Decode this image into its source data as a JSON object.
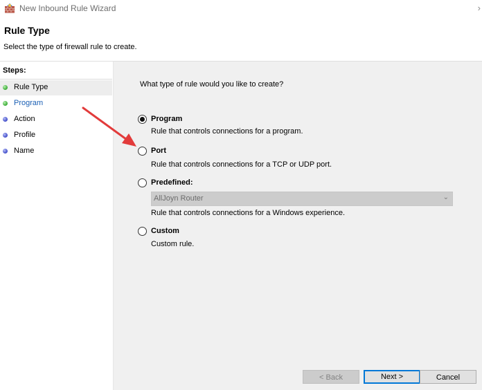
{
  "window": {
    "title": "New Inbound Rule Wizard"
  },
  "header": {
    "title": "Rule Type",
    "subtitle": "Select the type of firewall rule to create."
  },
  "steps": {
    "label": "Steps:",
    "items": [
      {
        "label": "Rule Type"
      },
      {
        "label": "Program"
      },
      {
        "label": "Action"
      },
      {
        "label": "Profile"
      },
      {
        "label": "Name"
      }
    ]
  },
  "content": {
    "question": "What type of rule would you like to create?",
    "options": [
      {
        "title": "Program",
        "desc": "Rule that controls connections for a program.",
        "selected": true
      },
      {
        "title": "Port",
        "desc": "Rule that controls connections for a TCP or UDP port.",
        "selected": false
      },
      {
        "title": "Predefined:",
        "desc": "Rule that controls connections for a Windows experience.",
        "selected": false
      },
      {
        "title": "Custom",
        "desc": "Custom rule.",
        "selected": false
      }
    ],
    "predefined_select": {
      "value": "AllJoyn Router",
      "enabled": false
    }
  },
  "buttons": {
    "back": "< Back",
    "next": "Next >",
    "cancel": "Cancel"
  },
  "annotation": {
    "type": "arrow",
    "color": "#e23b3b",
    "points_to": "Port"
  }
}
